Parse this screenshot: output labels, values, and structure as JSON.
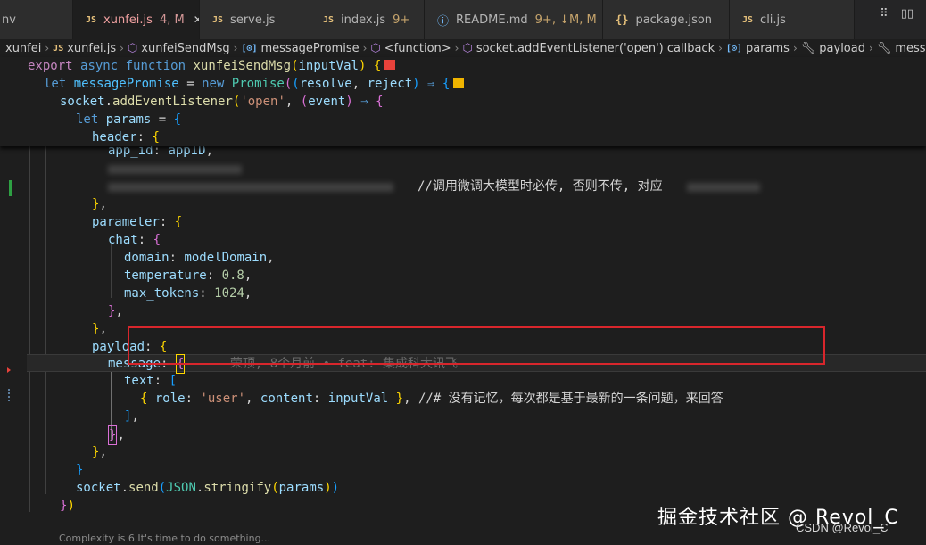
{
  "tabs": [
    {
      "name": "nv",
      "icon": "",
      "status": ""
    },
    {
      "name": "xunfei.js",
      "icon": "JS",
      "status": "4, M"
    },
    {
      "name": "serve.js",
      "icon": "JS",
      "status": ""
    },
    {
      "name": "index.js",
      "icon": "JS",
      "status": "9+"
    },
    {
      "name": "README.md",
      "icon": "ⓘ",
      "status": "9+, ↓M, M"
    },
    {
      "name": "package.json",
      "icon": "{}",
      "status": ""
    },
    {
      "name": "cli.js",
      "icon": "JS",
      "status": ""
    }
  ],
  "breadcrumb": [
    "xunfei",
    "xunfei.js",
    "xunfeiSendMsg",
    "messagePromise",
    "<function>",
    "socket.addEventListener('open') callback",
    "params",
    "payload",
    "message"
  ],
  "code": {
    "l1": [
      "export",
      "async",
      "function",
      "xunfeiSendMsg",
      "inputVal"
    ],
    "l2": [
      "let",
      "messagePromise",
      "new",
      "Promise",
      "resolve",
      "reject"
    ],
    "l3": [
      "socket",
      "addEventListener",
      "'open'",
      "event"
    ],
    "l4": [
      "let",
      "params"
    ],
    "l5": [
      "header"
    ],
    "l6": [
      "app_id",
      "appID"
    ],
    "l8_comment": "//调用微调大模型时必传, 否则不传, 对应",
    "l10": [
      "parameter"
    ],
    "l11": [
      "chat"
    ],
    "l12": [
      "domain",
      "modelDomain"
    ],
    "l13": [
      "temperature",
      "0.8"
    ],
    "l14": [
      "max_tokens",
      "1024"
    ],
    "l17": [
      "payload"
    ],
    "l18": [
      "message"
    ],
    "blame": "荣顶, 8个月前 • feat: 集成科大讯飞",
    "l19": [
      "text"
    ],
    "l20": [
      "role",
      "'user'",
      "content",
      "inputVal"
    ],
    "l20_comment": "//# 没有记忆，每次都是基于最新的一条问题，来回答",
    "l25": [
      "socket",
      "send",
      "JSON",
      "stringify",
      "params"
    ]
  },
  "status_hint": "Complexity is 6 It's time to do something...",
  "watermark": {
    "main": "掘金技术社区 @ Revol_C",
    "sub": "CSDN @Revol_C"
  },
  "colors": {
    "error_box": "#d8262c",
    "active_tab_text": "#f0a0a0",
    "square_red": "#e8423b",
    "square_yellow": "#f0b400"
  }
}
